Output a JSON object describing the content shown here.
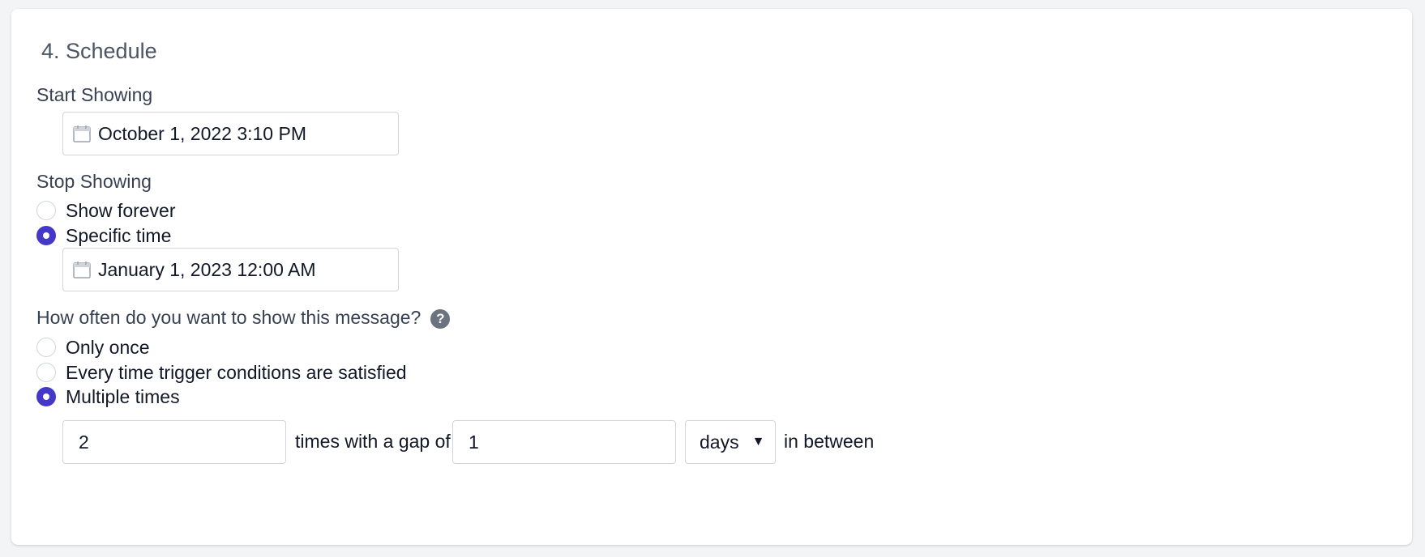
{
  "section": {
    "title": "4. Schedule"
  },
  "start_showing": {
    "label": "Start Showing",
    "value": "October 1, 2022 3:10 PM",
    "icon": "calendar-icon"
  },
  "stop_showing": {
    "label": "Stop Showing",
    "options": [
      {
        "label": "Show forever",
        "checked": false
      },
      {
        "label": "Specific time",
        "checked": true
      }
    ],
    "value": "January 1, 2023 12:00 AM",
    "icon": "calendar-icon"
  },
  "frequency": {
    "label": "How often do you want to show this message?",
    "help_icon": "?",
    "options": [
      {
        "label": "Only once",
        "checked": false
      },
      {
        "label": "Every time trigger conditions are satisfied",
        "checked": false
      },
      {
        "label": "Multiple times",
        "checked": true
      }
    ],
    "times_value": "2",
    "times_text": "times with a gap of",
    "gap_value": "1",
    "gap_unit": "days",
    "gap_unit_arrow": "▼",
    "suffix_text": "in between"
  },
  "colors": {
    "accent": "#4338ca",
    "border": "#d1d5db",
    "help_icon_bg": "#6b7280"
  }
}
